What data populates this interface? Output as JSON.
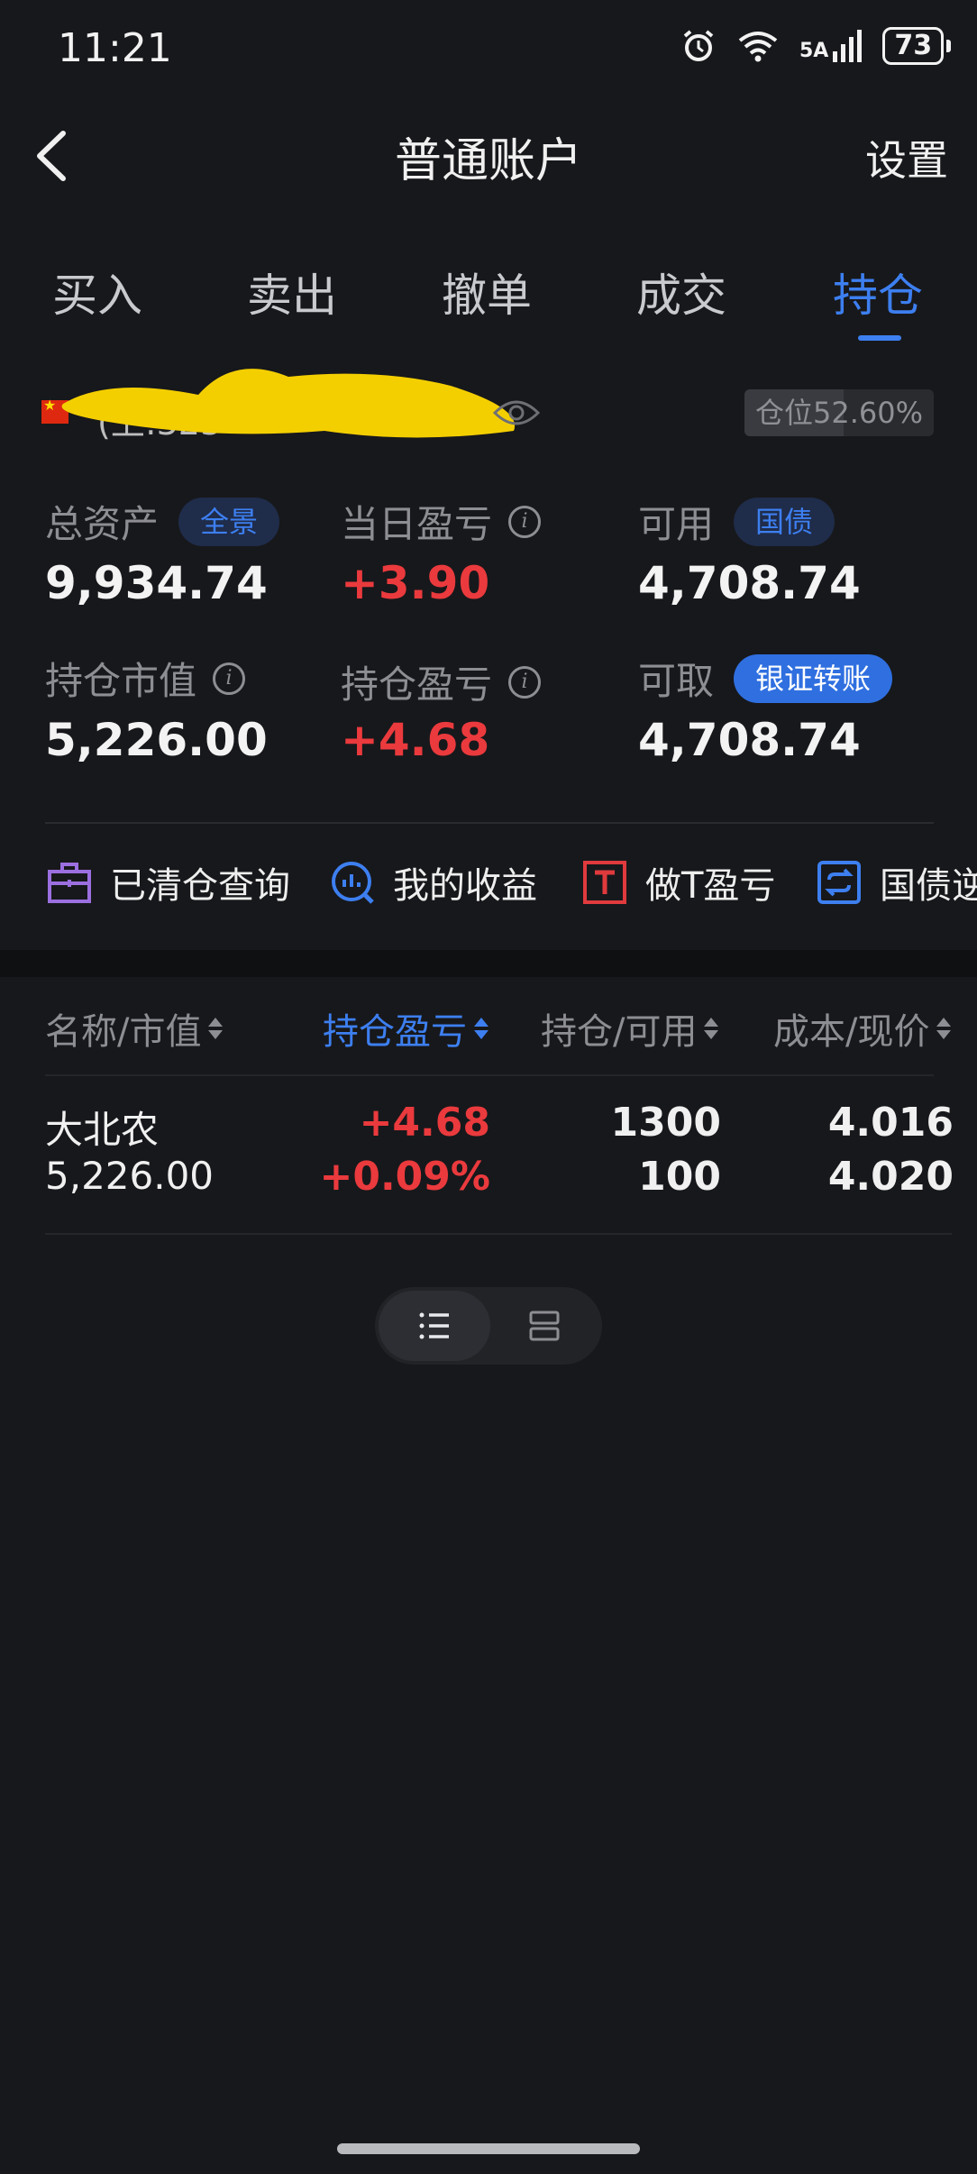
{
  "status_bar": {
    "time": "11:21",
    "network": "5A",
    "battery": "73"
  },
  "header": {
    "title": "普通账户",
    "settings_label": "设置"
  },
  "tabs": [
    {
      "label": "买入",
      "active": false
    },
    {
      "label": "卖出",
      "active": false
    },
    {
      "label": "撤单",
      "active": false
    },
    {
      "label": "成交",
      "active": false
    },
    {
      "label": "持仓",
      "active": true
    }
  ],
  "account": {
    "id_text": "(上:323",
    "position_label": "仓位52.60%",
    "position_ratio": 0.526
  },
  "stats": {
    "total_assets": {
      "label": "总资产",
      "badge": "全景",
      "value": "9,934.74"
    },
    "daily_pnl": {
      "label": "当日盈亏",
      "value": "+3.90"
    },
    "available": {
      "label": "可用",
      "badge": "国债",
      "value": "4,708.74"
    },
    "market_value": {
      "label": "持仓市值",
      "value": "5,226.00"
    },
    "position_pnl": {
      "label": "持仓盈亏",
      "value": "+4.68"
    },
    "withdrawable": {
      "label": "可取",
      "badge": "银证转账",
      "value": "4,708.74"
    }
  },
  "quick_actions": [
    {
      "label": "已清仓查询",
      "icon": "briefcase-icon",
      "color": "#9b6fe0"
    },
    {
      "label": "我的收益",
      "icon": "chart-search-icon",
      "color": "#3d7ff0"
    },
    {
      "label": "做T盈亏",
      "icon": "t-box-icon",
      "color": "#e03a3d"
    },
    {
      "label": "国债逆",
      "icon": "repeat-icon",
      "color": "#3d7ff0"
    }
  ],
  "table": {
    "headers": [
      "名称/市值",
      "持仓盈亏",
      "持仓/可用",
      "成本/现价"
    ],
    "active_header": 1,
    "rows": [
      {
        "name": "大北农",
        "market_value": "5,226.00",
        "pnl": "+4.68",
        "pnl_pct": "+0.09%",
        "holding": "1300",
        "available": "100",
        "cost": "4.016",
        "price": "4.020"
      }
    ]
  },
  "colors": {
    "accent": "#3d7ff0",
    "up": "#ea3a3d",
    "background": "#17181b"
  }
}
